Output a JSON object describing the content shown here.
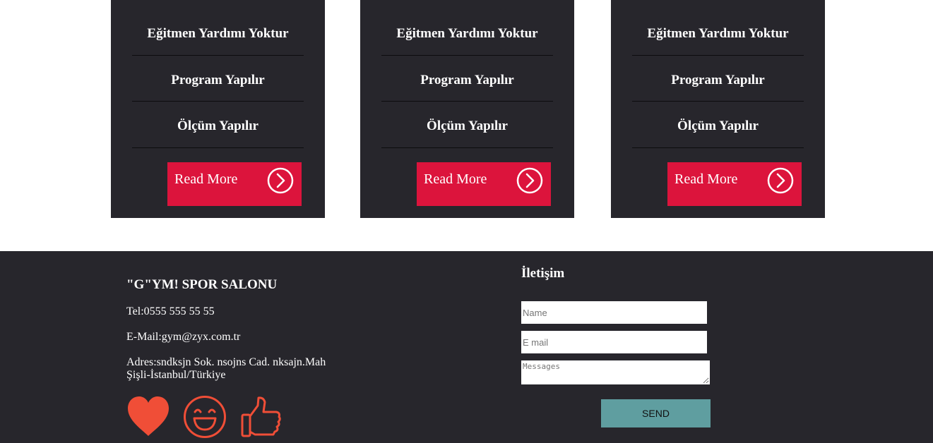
{
  "plans": [
    {
      "features": [
        "Eğitmen Yardımı Yoktur",
        "Program Yapılır",
        "Ölçüm Yapılır"
      ],
      "read_more_label": "Read More"
    },
    {
      "features": [
        "Eğitmen Yardımı Yoktur",
        "Program Yapılır",
        "Ölçüm Yapılır"
      ],
      "read_more_label": "Read More"
    },
    {
      "features": [
        "Eğitmen Yardımı Yoktur",
        "Program Yapılır",
        "Ölçüm Yapılır"
      ],
      "read_more_label": "Read More"
    }
  ],
  "footer": {
    "brand": "\"G\"YM! SPOR SALONU",
    "phone": "Tel:0555 555 55 55",
    "email": "E-Mail:gym@zyx.com.tr",
    "address_line1": "Adres:sndksjn Sok. nsojns Cad. nksajn.Mah",
    "address_line2": "Şişli-İstanbul/Türkiye",
    "social_icons": [
      "heart-icon",
      "smiley-icon",
      "thumbs-up-icon"
    ]
  },
  "contact": {
    "title": "İletişim",
    "name_placeholder": "Name",
    "email_placeholder": "E mail",
    "message_placeholder": "Messages",
    "send_label": "SEND"
  },
  "colors": {
    "card_bg": "#27262c",
    "accent": "#dc143c",
    "icon_orange": "#f04e37",
    "send_button": "#5f9ea0"
  }
}
